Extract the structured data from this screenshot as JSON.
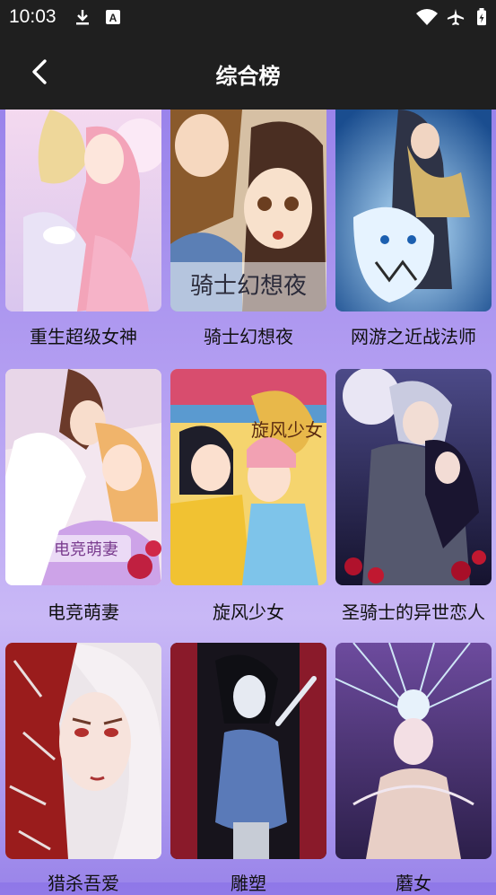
{
  "status_bar": {
    "time": "10:03",
    "icons": [
      "download-icon",
      "font-a-icon",
      "wifi-icon",
      "airplane-icon",
      "battery-icon"
    ]
  },
  "app_bar": {
    "title": "综合榜",
    "back_icon": "chevron-left-icon"
  },
  "comics": [
    {
      "title": "重生超级女神",
      "cover_overlay": ""
    },
    {
      "title": "骑士幻想夜",
      "cover_overlay": "骑士幻想夜"
    },
    {
      "title": "网游之近战法师",
      "cover_overlay": ""
    },
    {
      "title": "电竞萌妻",
      "cover_overlay": "电竞萌妻"
    },
    {
      "title": "旋风少女",
      "cover_overlay": "旋风少女"
    },
    {
      "title": "圣骑士的异世恋人",
      "cover_overlay": ""
    },
    {
      "title": "猎杀吾爱",
      "cover_overlay": ""
    },
    {
      "title": "雕塑",
      "cover_overlay": ""
    },
    {
      "title": "蘑女",
      "cover_overlay": ""
    }
  ],
  "colors": {
    "bar": "#1f1f1f",
    "background_top": "#8f78e8",
    "background_mid": "#c9b8f6"
  }
}
